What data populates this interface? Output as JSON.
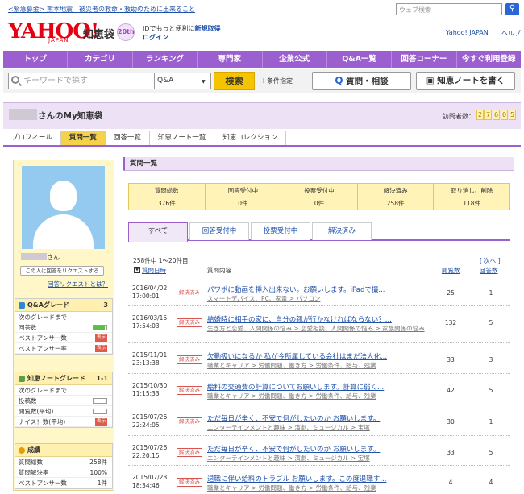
{
  "alert_text": "<緊急募金> 熊本地震　被災者の救命・救助のために出来ること",
  "web_search_placeholder": "ウェブ検索",
  "logo": {
    "text": "YAHOO!",
    "sub": "JAPAN",
    "service": "知恵袋",
    "badge": "20th"
  },
  "header": {
    "id_text": "IDでもっと便利に",
    "signup": "新規取得",
    "login": "ログイン",
    "yj": "Yahoo! JAPAN",
    "help": "ヘルプ"
  },
  "nav": [
    "トップ",
    "カテゴリ",
    "ランキング",
    "専門家",
    "企業公式",
    "Q&A一覧",
    "回答コーナー",
    "今すぐ利用登録"
  ],
  "search": {
    "placeholder": "キーワードで探す",
    "scope": "Q&A",
    "button": "検索",
    "condition": "条件指定",
    "ask": "質問・相談",
    "note": "知恵ノートを書く"
  },
  "profile": {
    "suffix": "さんのMy知恵袋",
    "visits_label": "訪問者数：",
    "visits": [
      "2",
      "7",
      "6",
      "0",
      "5"
    ]
  },
  "tabs": [
    "プロフィール",
    "質問一覧",
    "回答一覧",
    "知恵ノート一覧",
    "知恵コレクション"
  ],
  "sidebar": {
    "name_suffix": "さん",
    "request_button": "この人に回答をリクエストする",
    "request_link": "回答リクエストとは？",
    "qa_grade": {
      "title": "Q&Aグレード",
      "value": "3",
      "rows": [
        {
          "label": "次のグレードまで",
          "value": ""
        },
        {
          "label": "回答数",
          "value": ""
        },
        {
          "label": "ベストアンサー数",
          "value": "表示"
        },
        {
          "label": "ベストアンサー率",
          "value": "表示"
        }
      ]
    },
    "note_grade": {
      "title": "知恵ノートグレード",
      "value": "1-1",
      "rows": [
        {
          "label": "次のグレードまで",
          "value": ""
        },
        {
          "label": "投稿数",
          "value": ""
        },
        {
          "label": "閲覧数(平均)",
          "value": ""
        },
        {
          "label": "ナイス！数(平均)",
          "value": "表示"
        }
      ]
    },
    "results": {
      "title": "成績",
      "rows": [
        {
          "label": "質問総数",
          "value": "258件"
        },
        {
          "label": "質問解決率",
          "value": "100%"
        },
        {
          "label": "ベストアンサー数",
          "value": "1件"
        }
      ]
    }
  },
  "main": {
    "title": "質問一覧",
    "stats": [
      {
        "label": "質問総数",
        "value": "376件"
      },
      {
        "label": "回答受付中",
        "value": "0件"
      },
      {
        "label": "投票受付中",
        "value": "0件"
      },
      {
        "label": "解決済み",
        "value": "258件"
      },
      {
        "label": "取り消し、削除",
        "value": "118件"
      }
    ],
    "subtabs": [
      "すべて",
      "回答受付中",
      "投票受付中",
      "解決済み"
    ],
    "count": "258件中 1～20件目",
    "next": "[ 次へ ]",
    "headers": {
      "date": "質問日時",
      "content": "質問内容",
      "views": "閲覧数",
      "answers": "回答数"
    },
    "solved_label": "解決済み",
    "rows": [
      {
        "date": "2016/04/02 17:00:01",
        "title": "パワポに動画を挿入出来ない。お願いします。iPadで撮...",
        "category": "スマートデバイス、PC、家電 > パソコン",
        "views": "25",
        "answers": "1"
      },
      {
        "date": "2016/03/15 17:54:03",
        "title": "結婚時に相手の家に、自分の親が行かなければならない？...",
        "category": "生き方と恋愛、人間関係の悩み > 恋愛相談、人間関係の悩み > 家族関係の悩み",
        "views": "132",
        "answers": "5"
      },
      {
        "date": "2015/11/01 23:13:38",
        "title": "欠勤扱いになるか 私が今所属している会社はまだ法人化...",
        "category": "職業とキャリア > 労働問題、働き方 > 労働条件、給与、残業",
        "views": "33",
        "answers": "3"
      },
      {
        "date": "2015/10/30 11:15:33",
        "title": "給料の交通費の計算についてお願いします。計算に弱く...",
        "category": "職業とキャリア > 労働問題、働き方 > 労働条件、給与、残業",
        "views": "42",
        "answers": "5"
      },
      {
        "date": "2015/07/26 22:24:05",
        "title": "ただ毎日が辛く、不安で何がしたいのか お願いします。",
        "category": "エンターテインメントと趣味 > 演劇、ミュージカル > 宝塚",
        "views": "30",
        "answers": "1"
      },
      {
        "date": "2015/07/26 22:20:15",
        "title": "ただ毎日が辛く、不安で何がしたいのか お願いします。",
        "category": "エンターテインメントと趣味 > 演劇、ミュージカル > 宝塚",
        "views": "33",
        "answers": "5"
      },
      {
        "date": "2015/07/23 18:34:46",
        "title": "退職に伴い給料のトラブル お願いします。この度退職す...",
        "category": "職業とキャリア > 労働問題、働き方 > 労働条件、給与、残業",
        "views": "4",
        "answers": "4"
      }
    ]
  }
}
